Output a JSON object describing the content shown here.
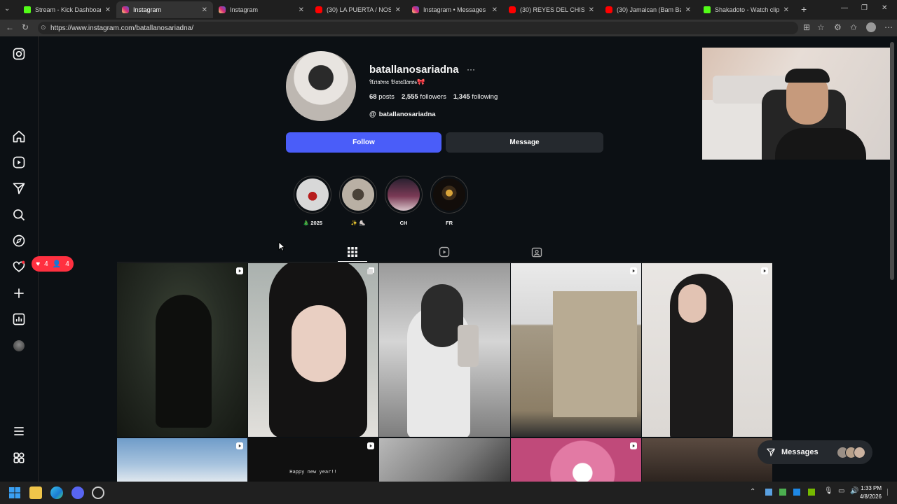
{
  "browser": {
    "tabs": [
      {
        "label": "Stream - Kick Dashboard",
        "favicon": "kick-icon"
      },
      {
        "label": "Instagram",
        "favicon": "instagram-icon"
      },
      {
        "label": "Instagram",
        "favicon": "instagram-icon"
      },
      {
        "label": "(30) LA PUERTA / NOS QUER",
        "favicon": "youtube-icon"
      },
      {
        "label": "Instagram • Messages",
        "favicon": "instagram-icon"
      },
      {
        "label": "(30) REYES DEL CHISME Y DE",
        "favicon": "youtube-icon"
      },
      {
        "label": "(30) Jamaican (Bam Bam) - Y",
        "favicon": "youtube-icon"
      },
      {
        "label": "Shakadoto - Watch clips on",
        "favicon": "kick-icon"
      }
    ],
    "url": "https://www.instagram.com/batallanosariadna/"
  },
  "sidebar": {
    "notifications": {
      "likes": "4",
      "follows": "4"
    }
  },
  "profile": {
    "username": "batallanosariadna",
    "more": "···",
    "full_name": "𝔄𝔯𝔦𝔞𝔡𝔫𝔞 𝔅𝔞𝔱𝔞𝔩𝔩𝔞𝔫𝔬𝔰🎀",
    "posts_count": "68",
    "posts_label": "posts",
    "followers_count": "2,555",
    "followers_label": "followers",
    "following_count": "1,345",
    "following_label": "following",
    "threads_handle": "batallanosariadna",
    "follow_label": "Follow",
    "message_label": "Message"
  },
  "highlights": [
    {
      "label": "🎄 2025"
    },
    {
      "label": "✨ ⛸️"
    },
    {
      "label": "CH"
    },
    {
      "label": "FR"
    }
  ],
  "grid_second_row_text": "Happy new year!!",
  "messages_pill": {
    "label": "Messages"
  },
  "taskbar": {
    "time": "1:33 PM",
    "date": "4/8/2026"
  },
  "colors": {
    "follow_button": "#4a5df9",
    "notification": "#ff3040",
    "background": "#0c1014"
  }
}
